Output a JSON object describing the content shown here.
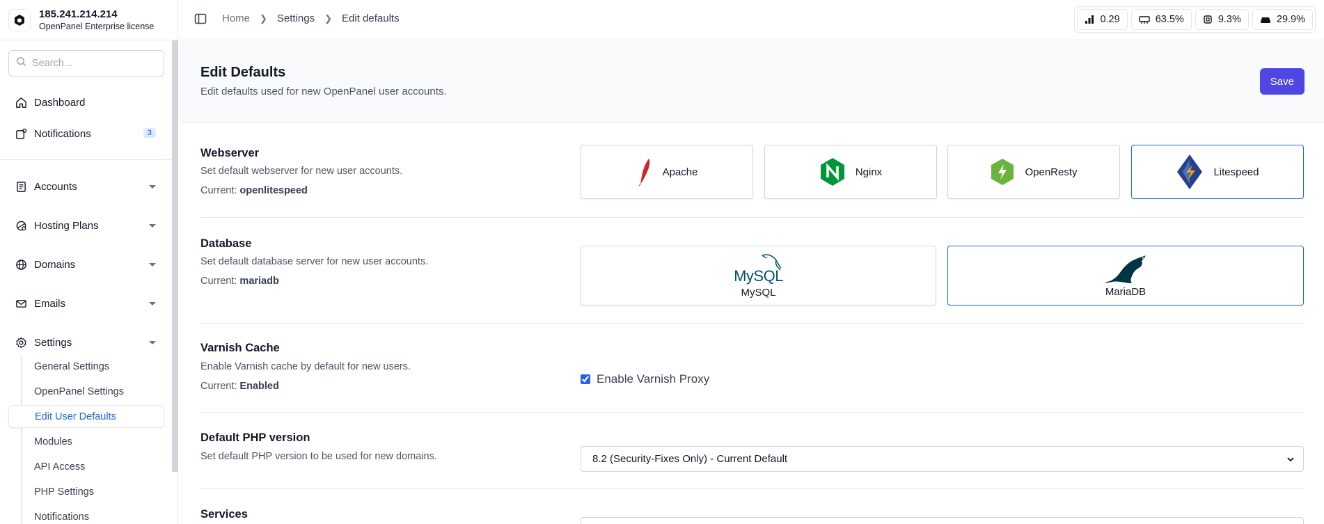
{
  "sidebar": {
    "server_ip": "185.241.214.214",
    "license": "OpenPanel Enterprise license",
    "search_placeholder": "Search...",
    "items": [
      {
        "label": "Dashboard"
      },
      {
        "label": "Notifications",
        "badge": "3"
      },
      {
        "label": "Accounts"
      },
      {
        "label": "Hosting Plans"
      },
      {
        "label": "Domains"
      },
      {
        "label": "Emails"
      },
      {
        "label": "Settings"
      }
    ],
    "settings_sub": [
      {
        "label": "General Settings"
      },
      {
        "label": "OpenPanel Settings"
      },
      {
        "label": "Edit User Defaults",
        "active": true
      },
      {
        "label": "Modules"
      },
      {
        "label": "API Access"
      },
      {
        "label": "PHP Settings"
      },
      {
        "label": "Notifications"
      }
    ]
  },
  "topbar": {
    "breadcrumb": [
      "Home",
      "Settings",
      "Edit defaults"
    ],
    "stats": [
      {
        "icon": "load-icon",
        "value": "0.29"
      },
      {
        "icon": "memory-icon",
        "value": "63.5%"
      },
      {
        "icon": "cpu-icon",
        "value": "9.3%"
      },
      {
        "icon": "disk-icon",
        "value": "29.9%"
      }
    ]
  },
  "header": {
    "title": "Edit Defaults",
    "subtitle": "Edit defaults used for new OpenPanel user accounts.",
    "save_label": "Save"
  },
  "webserver": {
    "title": "Webserver",
    "desc": "Set default webserver for new user accounts.",
    "current_label": "Current:",
    "current_value": "openlitespeed",
    "options": [
      {
        "label": "Apache",
        "icon": "apache-feather-icon"
      },
      {
        "label": "Nginx",
        "icon": "nginx-icon"
      },
      {
        "label": "OpenResty",
        "icon": "openresty-icon"
      },
      {
        "label": "Litespeed",
        "icon": "litespeed-icon",
        "selected": true
      }
    ]
  },
  "database": {
    "title": "Database",
    "desc": "Set default database server for new user accounts.",
    "current_label": "Current:",
    "current_value": "mariadb",
    "options": [
      {
        "label": "MySQL",
        "logo_text": "MySQL",
        "icon": "mysql-dolphin-icon"
      },
      {
        "label": "MariaDB",
        "icon": "mariadb-seal-icon",
        "selected": true
      }
    ]
  },
  "varnish": {
    "title": "Varnish Cache",
    "desc": "Enable Varnish cache by default for new users.",
    "current_label": "Current:",
    "current_value": "Enabled",
    "checkbox_label": "Enable Varnish Proxy",
    "checked": true
  },
  "php": {
    "title": "Default PHP version",
    "desc": "Set default PHP version to be used for new domains.",
    "selected": "8.2 (Security-Fixes Only) - Current Default"
  },
  "services": {
    "title": "Services"
  },
  "colors": {
    "accent": "#4f46e5",
    "selected_border": "#2563eb",
    "active_link": "#2563eb"
  }
}
